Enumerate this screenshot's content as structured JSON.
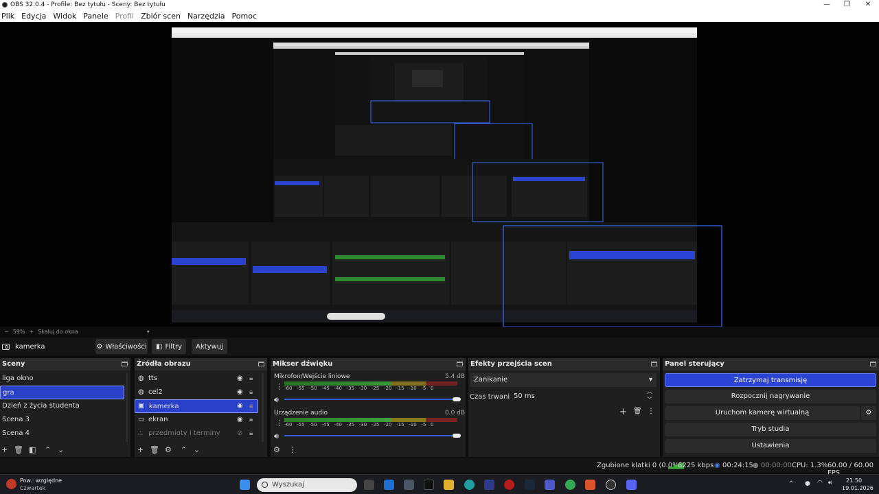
{
  "window": {
    "title": "OBS 32.0.4 - Profile: Bez tytułu - Sceny: Bez tytułu"
  },
  "menu": [
    "Plik",
    "Edycja",
    "Widok",
    "Panele",
    "Profil",
    "Zbiór scen",
    "Narzędzia",
    "Pomoc"
  ],
  "zoom": {
    "value": "59%",
    "scale_label": "Skaluj do okna"
  },
  "source_toolbar": {
    "selected": "kamerka",
    "properties": "Właściwości",
    "filters": "Filtry",
    "activate": "Aktywuj"
  },
  "scenes": {
    "title": "Sceny",
    "items": [
      "liga okno",
      "gra",
      "Dzień z życia studenta",
      "Scena 3",
      "Scena 4"
    ],
    "selected": 1
  },
  "sources": {
    "title": "Źródła obrazu",
    "items": [
      "tts",
      "cel2",
      "kamerka",
      "ekran",
      "przedmioty i terminy"
    ],
    "selected": 2
  },
  "mixer": {
    "title": "Mikser dźwięku",
    "tracks": [
      {
        "name": "Mikrofon/Wejście liniowe",
        "db": "5.4 dB"
      },
      {
        "name": "Urządzenie audio",
        "db": "0.0 dB"
      }
    ],
    "ticks": [
      "-60",
      "-55",
      "-50",
      "-45",
      "-40",
      "-35",
      "-30",
      "-25",
      "-20",
      "-15",
      "-10",
      "-5",
      "0"
    ]
  },
  "transitions": {
    "title": "Efekty przejścia scen",
    "type": "Zanikanie",
    "duration_label": "Czas trwania",
    "duration": "50 ms"
  },
  "controls": {
    "title": "Panel sterujący",
    "stop_stream": "Zatrzymaj transmisję",
    "start_record": "Rozpocznij nagrywanie",
    "virtual_cam": "Uruchom kamerę wirtualną",
    "studio_mode": "Tryb studia",
    "settings": "Ustawienia"
  },
  "status": {
    "dropped": "Zgubione klatki 0 (0.0%)",
    "bitrate": "6225 kbps",
    "stream_time": "00:24:15",
    "rec_time": "00:00:00",
    "cpu": "CPU: 1.3%",
    "fps": "60.00 / 60.00 FPS"
  },
  "taskbar": {
    "weather_line1": "Pow.: względne",
    "weather_line2": "Czwartek",
    "search": "Wyszukaj",
    "time": "21:50",
    "date": "19.01.2026"
  }
}
